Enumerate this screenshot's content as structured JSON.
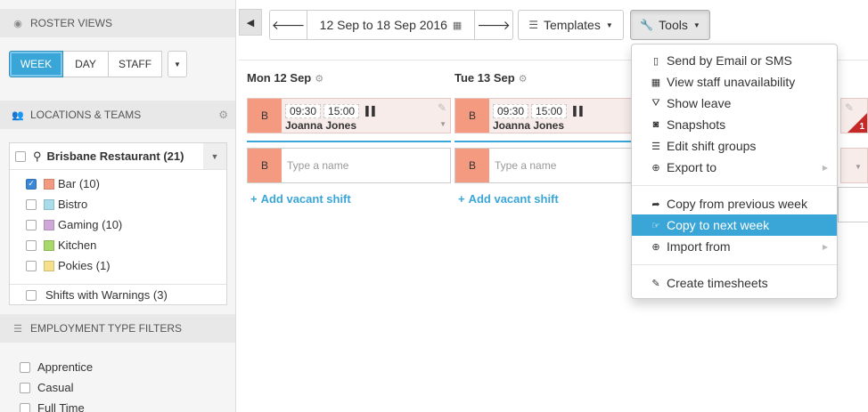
{
  "sidebar": {
    "roster_views_title": "ROSTER VIEWS",
    "view_buttons": {
      "week": "WEEK",
      "day": "DAY",
      "staff": "STAFF"
    },
    "locations_title": "LOCATIONS & TEAMS",
    "location": {
      "name": "Brisbane Restaurant",
      "count": "(21)"
    },
    "teams": [
      {
        "label": "Bar (10)",
        "color": "#f49a80",
        "checked": true
      },
      {
        "label": "Bistro",
        "color": "#a8dcea",
        "checked": false
      },
      {
        "label": "Gaming (10)",
        "color": "#cfa8d8",
        "checked": false
      },
      {
        "label": "Kitchen",
        "color": "#a8d86a",
        "checked": false
      },
      {
        "label": "Pokies (1)",
        "color": "#f5e08c",
        "checked": false
      }
    ],
    "warnings_label": "Shifts with Warnings (3)",
    "employment_title": "EMPLOYMENT TYPE FILTERS",
    "employment_types": [
      "Apprentice",
      "Casual",
      "Full Time"
    ]
  },
  "toolbar": {
    "collapse_icon": "chevron-left-icon",
    "date_range": "12 Sep to 18 Sep 2016",
    "templates_label": "Templates",
    "tools_label": "Tools"
  },
  "columns": [
    {
      "day": "Mon 12 Sep",
      "shift": {
        "badge": "B",
        "start": "09:30",
        "end": "15:00",
        "employee": "Joanna Jones"
      },
      "name_badge": "B",
      "name_placeholder": "Type a name",
      "add_label": "Add vacant shift"
    },
    {
      "day": "Tue 13 Sep",
      "shift": {
        "badge": "B",
        "start": "09:30",
        "end": "15:00",
        "employee": "Joanna Jones"
      },
      "name_badge": "B",
      "name_placeholder": "Type a name",
      "add_label": "Add vacant shift"
    }
  ],
  "warning_count": "1",
  "tools_menu": {
    "send": "Send by Email or SMS",
    "unavailability": "View staff unavailability",
    "leave": "Show leave",
    "snapshots": "Snapshots",
    "shift_groups": "Edit shift groups",
    "export": "Export to",
    "copy_prev": "Copy from previous week",
    "copy_next": "Copy to next week",
    "import": "Import from",
    "timesheets": "Create timesheets"
  },
  "colors": {
    "accent": "#3aa6d8",
    "warning": "#c62828",
    "badge": "#f49a80"
  }
}
